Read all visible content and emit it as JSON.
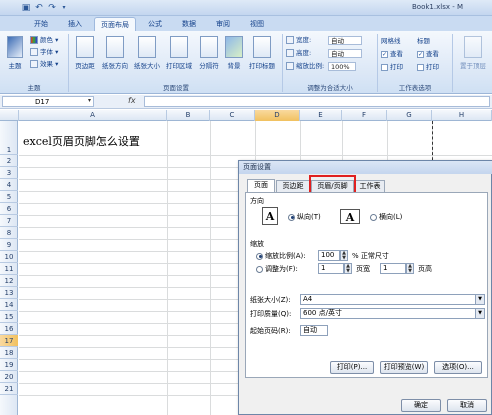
{
  "window": {
    "title": "Book1.xlsx - M"
  },
  "tabs": [
    "开始",
    "插入",
    "页面布局",
    "公式",
    "数据",
    "审阅",
    "视图"
  ],
  "ribbon": {
    "themes": {
      "label": "主题",
      "colors": "颜色",
      "fonts": "字体",
      "effects": "效果",
      "group": "主题"
    },
    "page_setup": {
      "buttons": [
        "页边距",
        "纸张方向",
        "纸张大小",
        "打印区域",
        "分隔符",
        "背景",
        "打印标题"
      ],
      "group": "页面设置"
    },
    "scale": {
      "width_label": "宽度:",
      "width_value": "自动",
      "height_label": "高度:",
      "height_value": "自动",
      "zoom_label": "缩放比例:",
      "zoom_value": "100%",
      "group": "调整为合适大小"
    },
    "sheet_options": {
      "gridlines": "网格线",
      "headings": "标题",
      "view": "查看",
      "print": "打印",
      "group": "工作表选项"
    },
    "arrange": {
      "label": "置于顶层"
    }
  },
  "formula_bar": {
    "name_box": "D17",
    "fx": "fx",
    "value": ""
  },
  "columns": [
    "A",
    "B",
    "C",
    "D",
    "E",
    "F",
    "G",
    "H"
  ],
  "rows": [
    "1",
    "2",
    "3",
    "4",
    "5",
    "6",
    "7",
    "8",
    "9",
    "10",
    "11",
    "12",
    "13",
    "14",
    "15",
    "16",
    "17",
    "18",
    "19",
    "20",
    "21"
  ],
  "cells": {
    "A1": "excel页眉页脚怎么设置"
  },
  "dialog": {
    "title": "页面设置",
    "tabs": [
      "页面",
      "页边距",
      "页眉/页脚",
      "工作表"
    ],
    "orientation_label": "方向",
    "portrait": "纵向(T)",
    "landscape": "横向(L)",
    "scaling_label": "缩放",
    "zoom_option": "缩放比例(A):",
    "zoom_value": "100",
    "zoom_suffix": "% 正常尺寸",
    "fit_option": "调整为(F):",
    "fit_pages_wide": "1",
    "fit_wide_suffix": "页宽",
    "fit_pages_tall": "1",
    "fit_tall_suffix": "页高",
    "paper_size_label": "纸张大小(Z):",
    "paper_size_value": "A4",
    "print_quality_label": "打印质量(Q):",
    "print_quality_value": "600 点/英寸",
    "first_page_label": "起始页码(R):",
    "first_page_value": "自动",
    "print_button": "打印(P)...",
    "preview_button": "打印预览(W)",
    "options_button": "选项(O)...",
    "ok_button": "确定",
    "cancel_button": "取消"
  },
  "colors": {
    "accent": "#15428b",
    "highlight": "#e02020",
    "selected_header": "#f1c15f"
  }
}
